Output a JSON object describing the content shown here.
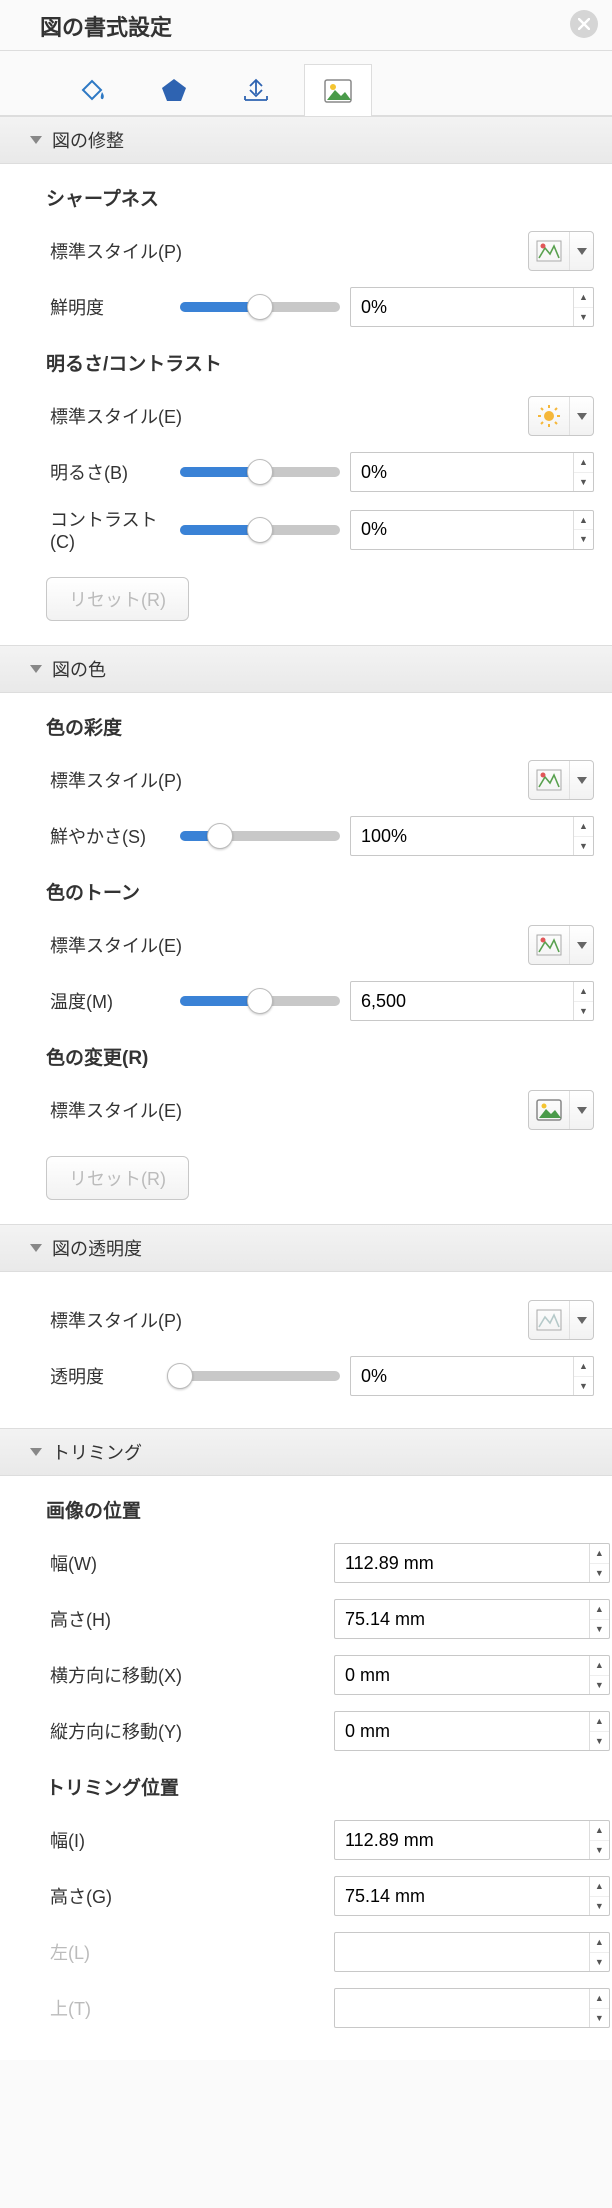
{
  "title": "図の書式設定",
  "sections": {
    "corrections": {
      "header": "図の修整",
      "sharpness": {
        "title": "シャープネス",
        "preset_label": "標準スタイル(P)",
        "sharpness_label": "鮮明度",
        "sharpness_value": "0%"
      },
      "brightcontrast": {
        "title": "明るさ/コントラスト",
        "preset_label": "標準スタイル(E)",
        "brightness_label": "明るさ(B)",
        "brightness_value": "0%",
        "contrast_label": "コントラスト(C)",
        "contrast_value": "0%",
        "reset_label": "リセット(R)"
      }
    },
    "color": {
      "header": "図の色",
      "saturation": {
        "title": "色の彩度",
        "preset_label": "標準スタイル(P)",
        "vividness_label": "鮮やかさ(S)",
        "vividness_value": "100%"
      },
      "tone": {
        "title": "色のトーン",
        "preset_label": "標準スタイル(E)",
        "temp_label": "温度(M)",
        "temp_value": "6,500"
      },
      "recolor": {
        "title": "色の変更(R)",
        "preset_label": "標準スタイル(E)",
        "reset_label": "リセット(R)"
      }
    },
    "transparency": {
      "header": "図の透明度",
      "preset_label": "標準スタイル(P)",
      "trans_label": "透明度",
      "trans_value": "0%"
    },
    "crop": {
      "header": "トリミング",
      "position": {
        "title": "画像の位置",
        "width_label": "幅(W)",
        "width_value": "112.89 mm",
        "height_label": "高さ(H)",
        "height_value": "75.14 mm",
        "offx_label": "横方向に移動(X)",
        "offx_value": "0 mm",
        "offy_label": "縦方向に移動(Y)",
        "offy_value": "0 mm"
      },
      "cropPosition": {
        "title": "トリミング位置",
        "width_label": "幅(I)",
        "width_value": "112.89 mm",
        "height_label": "高さ(G)",
        "height_value": "75.14 mm",
        "left_label": "左(L)",
        "left_value": "",
        "top_label": "上(T)",
        "top_value": ""
      }
    }
  }
}
